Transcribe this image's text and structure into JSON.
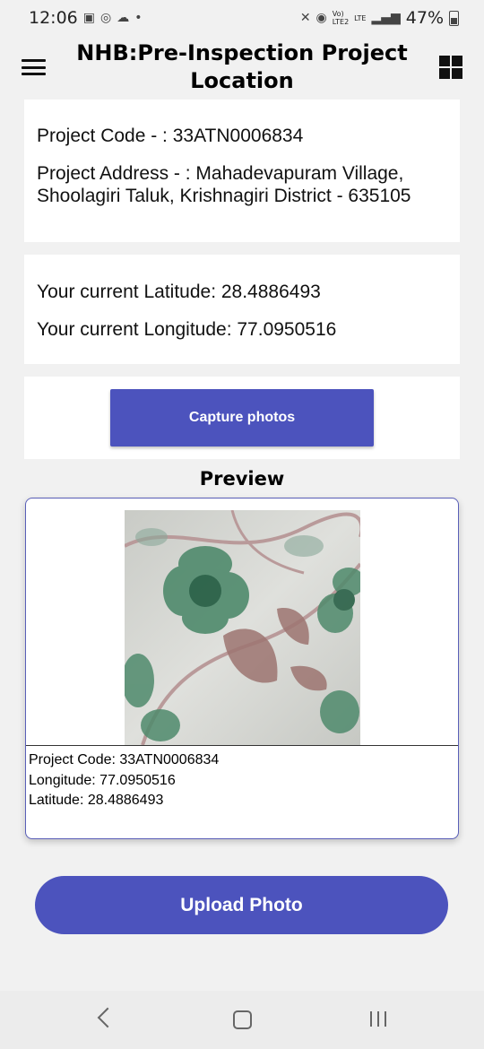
{
  "status_bar": {
    "time": "12:06",
    "network_lines": [
      "Vo)",
      "LTE2"
    ],
    "network_lte": "LTE",
    "battery": "47%"
  },
  "app_bar": {
    "title": "NHB:Pre-Inspection Project Location"
  },
  "project": {
    "code_text": "Project Code - : 33ATN0006834",
    "address_text": "Project Address - : Mahadevapuram Village, Shoolagiri Taluk, Krishnagiri District - 635105"
  },
  "location": {
    "latitude_text": "Your current Latitude: 28.4886493",
    "longitude_text": "Your current Longitude: 77.0950516"
  },
  "capture": {
    "button_label": "Capture photos"
  },
  "preview": {
    "heading": "Preview",
    "caption_code": "Project Code: 33ATN0006834",
    "caption_longitude": "Longitude: 77.0950516",
    "caption_latitude": "Latitude: 28.4886493"
  },
  "upload": {
    "button_label": "Upload Photo"
  },
  "colors": {
    "accent": "#4c53bd",
    "background": "#f1f1f1",
    "card": "#ffffff"
  },
  "icons": [
    "image-icon",
    "whatsapp-icon",
    "cloud-icon",
    "mute-icon",
    "hotspot-icon",
    "signal-icon",
    "battery-icon",
    "menu-icon",
    "grid-icon",
    "back-icon",
    "home-icon",
    "recents-icon"
  ]
}
